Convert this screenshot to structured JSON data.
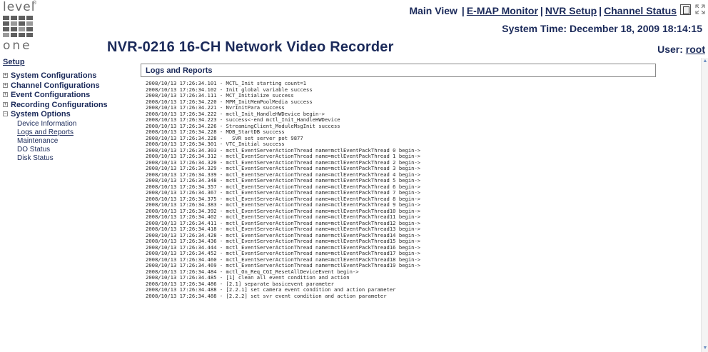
{
  "logo": {
    "top": "level",
    "bottom": "one",
    "reg": "®"
  },
  "header": {
    "main_view": "Main View",
    "sep": "|",
    "links": [
      "E-MAP Monitor",
      "NVR Setup",
      "Channel Status"
    ],
    "system_time_label": "System Time:",
    "system_time_value": "December 18, 2009 18:14:15",
    "device_title": "NVR-0216 16-CH Network Video Recorder",
    "user_label": "User:",
    "user_value": "root"
  },
  "sidebar": {
    "setup": "Setup",
    "items": [
      {
        "label": "System Configurations",
        "toggle": "+"
      },
      {
        "label": "Channel Configurations",
        "toggle": "+"
      },
      {
        "label": "Event Configurations",
        "toggle": "+"
      },
      {
        "label": "Recording Configurations",
        "toggle": "+"
      },
      {
        "label": "System Options",
        "toggle": "−"
      }
    ],
    "sub_items": [
      "Device Information",
      "Logs and Reports",
      "Maintenance",
      "DO Status",
      "Disk Status"
    ],
    "active_sub": 1
  },
  "panel": {
    "title": "Logs and Reports"
  },
  "logs": [
    "2008/10/13 17:26:34.101 - MCTL_Init starting count=1",
    "2008/10/13 17:26:34.102 - Init global variable success",
    "2008/10/13 17:26:34.111 - MCT_Initialize success",
    "2008/10/13 17:26:34.220 - MPM_InitMemPoolMedia success",
    "2008/10/13 17:26:34.221 - NvrInitPara success",
    "2008/10/13 17:26:34.222 - mctl_Init_HandleHWDevice begin->",
    "2008/10/13 17:26:34.223 - success<-end mctl_Init_HandleHWDevice",
    "2008/10/13 17:26:34.226 - StreamingClient_ModuleMsgInit success",
    "2008/10/13 17:26:34.228 - MDB_StartDB success",
    "2008/10/13 17:26:34.228 -   SVR set server pot 9877",
    "2008/10/13 17:26:34.301 - VTC_Initial success",
    "2008/10/13 17:26:34.303 - mctl_EventServerActionThread name=mctlEventPackThread 0 begin->",
    "2008/10/13 17:26:34.312 - mctl_EventServerActionThread name=mctlEventPackThread 1 begin->",
    "2008/10/13 17:26:34.320 - mctl_EventServerActionThread name=mctlEventPackThread 2 begin->",
    "2008/10/13 17:26:34.329 - mctl_EventServerActionThread name=mctlEventPackThread 3 begin->",
    "2008/10/13 17:26:34.339 - mctl_EventServerActionThread name=mctlEventPackThread 4 begin->",
    "2008/10/13 17:26:34.348 - mctl_EventServerActionThread name=mctlEventPackThread 5 begin->",
    "2008/10/13 17:26:34.357 - mctl_EventServerActionThread name=mctlEventPackThread 6 begin->",
    "2008/10/13 17:26:34.367 - mctl_EventServerActionThread name=mctlEventPackThread 7 begin->",
    "2008/10/13 17:26:34.375 - mctl_EventServerActionThread name=mctlEventPackThread 8 begin->",
    "2008/10/13 17:26:34.383 - mctl_EventServerActionThread name=mctlEventPackThread 9 begin->",
    "2008/10/13 17:26:34.392 - mctl_EventServerActionThread name=mctlEventPackThread10 begin->",
    "2008/10/13 17:26:34.402 - mctl_EventServerActionThread name=mctlEventPackThread11 begin->",
    "2008/10/13 17:26:34.411 - mctl_EventServerActionThread name=mctlEventPackThread12 begin->",
    "2008/10/13 17:26:34.418 - mctl_EventServerActionThread name=mctlEventPackThread13 begin->",
    "2008/10/13 17:26:34.428 - mctl_EventServerActionThread name=mctlEventPackThread14 begin->",
    "2008/10/13 17:26:34.436 - mctl_EventServerActionThread name=mctlEventPackThread15 begin->",
    "2008/10/13 17:26:34.444 - mctl_EventServerActionThread name=mctlEventPackThread16 begin->",
    "2008/10/13 17:26:34.452 - mctl_EventServerActionThread name=mctlEventPackThread17 begin->",
    "2008/10/13 17:26:34.460 - mctl_EventServerActionThread name=mctlEventPackThread18 begin->",
    "2008/10/13 17:26:34.469 - mctl_EventServerActionThread name=mctlEventPackThread19 begin->",
    "2008/10/13 17:26:34.484 - mctl_On_Req_CGI_ResetAllDeviceEvent begin->",
    "2008/10/13 17:26:34.485 - [1] clean all event condition and action",
    "2008/10/13 17:26:34.486 - [2.1] separate basicevent parameter",
    "2008/10/13 17:26:34.488 - [2.2.1] set camera event condition and action parameter",
    "2008/10/13 17:26:34.488 - [2.2.2] set svr event condition and action parameter"
  ],
  "colors": {
    "text": "#1b2a5a",
    "border": "#8a8a8a",
    "log_text": "#2a2a2a"
  },
  "icons": [
    "help-icon",
    "fullscreen-icon",
    "scroll-up-icon",
    "scroll-down-icon"
  ]
}
